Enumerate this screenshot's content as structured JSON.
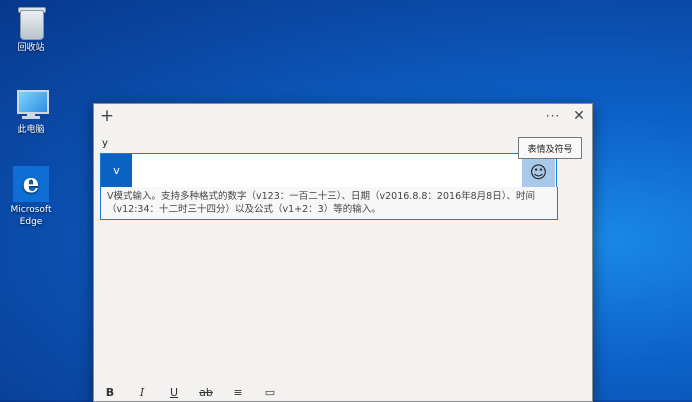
{
  "desktop": {
    "icons": [
      {
        "label": "回收站",
        "icon": "recycle-bin-icon"
      },
      {
        "label": "此电脑",
        "icon": "computer-icon"
      },
      {
        "label": "Microsoft\nEdge",
        "icon": "edge-icon"
      }
    ]
  },
  "window": {
    "titlebar": {
      "add": "+",
      "more": "···",
      "close": "✕"
    },
    "typed_text": "y",
    "ime": {
      "badge": "v",
      "emoji_glyph": "☺",
      "emoji_tooltip": "表情及符号",
      "hint": "V模式输入。支持多种格式的数字（v123：一百二十三）、日期（v2016.8.8：2016年8月8日）、时间（v12:34：十二时三十四分）以及公式（v1+2：3）等的输入。"
    },
    "format_toolbar": [
      "B",
      "I",
      "U",
      "ab",
      "≡",
      "▭"
    ]
  },
  "colors": {
    "accent": "#0a63c2",
    "emoji_bg": "#a8c9ea"
  }
}
